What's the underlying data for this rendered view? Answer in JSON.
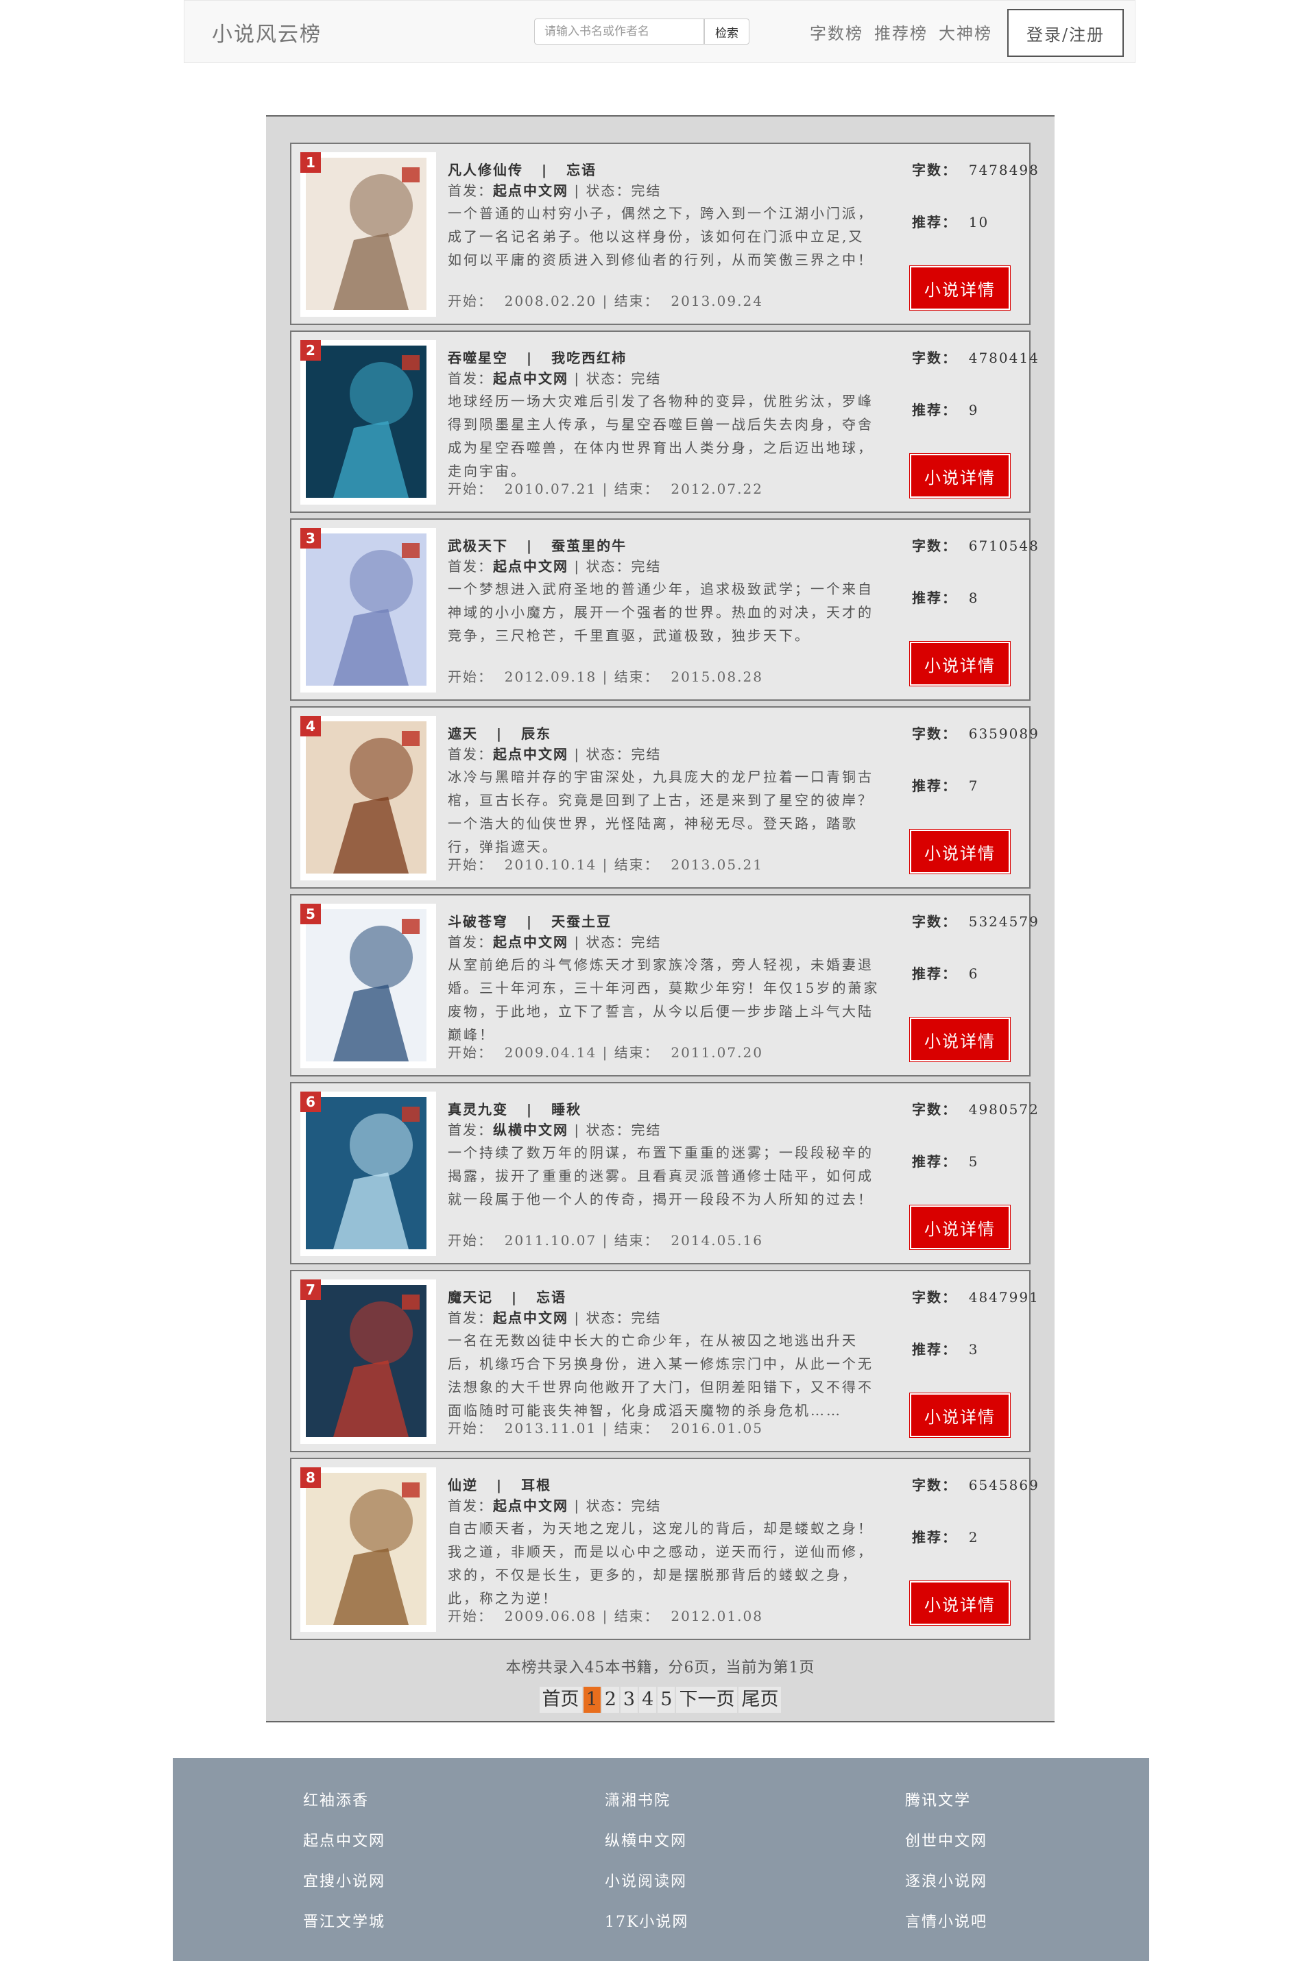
{
  "header": {
    "brand": "小说风云榜",
    "search_placeholder": "请输入书名或作者名",
    "search_button": "检索",
    "nav": [
      "字数榜",
      "推荐榜",
      "大神榜"
    ],
    "login": "登录/注册"
  },
  "labels": {
    "first_pub": "首发：",
    "status": "状态：",
    "start": "开始：",
    "end": "结束：",
    "words": "字数：",
    "recommend": "推荐：",
    "detail_button": "小说详情"
  },
  "books": [
    {
      "rank": "1",
      "title": "凡人修仙传",
      "author": "忘语",
      "site": "起点中文网",
      "status": "完结",
      "desc": "一个普通的山村穷小子，偶然之下，跨入到一个江湖小门派，成了一名记名弟子。他以这样身份，该如何在门派中立足,又如何以平庸的资质进入到修仙者的行列，从而笑傲三界之中！",
      "start": "2008.02.20",
      "end": "2013.09.24",
      "words": "7478498",
      "recommend": "10",
      "cover_bg": "#efe6dc",
      "cover_accent": "#8a6a50"
    },
    {
      "rank": "2",
      "title": "吞噬星空",
      "author": "我吃西红柿",
      "site": "起点中文网",
      "status": "完结",
      "desc": "地球经历一场大灾难后引发了各物种的变异，优胜劣汰，罗峰得到陨墨星主人传承，与星空吞噬巨兽一战后失去肉身，夺舍成为星空吞噬兽，在体内世界育出人类分身，之后迈出地球，走向宇宙。",
      "start": "2010.07.21",
      "end": "2012.07.22",
      "words": "4780414",
      "recommend": "9",
      "cover_bg": "#0f3c55",
      "cover_accent": "#3ea9c9"
    },
    {
      "rank": "3",
      "title": "武极天下",
      "author": "蚕茧里的牛",
      "site": "起点中文网",
      "status": "完结",
      "desc": "一个梦想进入武府圣地的普通少年，追求极致武学；一个来自神域的小小魔方，展开一个强者的世界。热血的对决，天才的竞争，三尺枪芒，千里直驱，武道极致，独步天下。",
      "start": "2012.09.18",
      "end": "2015.08.28",
      "words": "6710548",
      "recommend": "8",
      "cover_bg": "#c9d3ee",
      "cover_accent": "#6f7fb8"
    },
    {
      "rank": "4",
      "title": "遮天",
      "author": "辰东",
      "site": "起点中文网",
      "status": "完结",
      "desc": "冰冷与黑暗并存的宇宙深处，九具庞大的龙尸拉着一口青铜古棺，亘古长存。究竟是回到了上古，还是来到了星空的彼岸？一个浩大的仙侠世界，光怪陆离，神秘无尽。登天路，踏歌行，弹指遮天。",
      "start": "2010.10.14",
      "end": "2013.05.21",
      "words": "6359089",
      "recommend": "7",
      "cover_bg": "#e9d7c2",
      "cover_accent": "#7a3a1a"
    },
    {
      "rank": "5",
      "title": "斗破苍穹",
      "author": "天蚕土豆",
      "site": "起点中文网",
      "status": "完结",
      "desc": "从室前绝后的斗气修炼天才到家族冷落，旁人轻视，未婚妻退婚。三十年河东，三十年河西，莫欺少年穷！年仅15岁的萧家废物，于此地，立下了誓言，从今以后便一步步踏上斗气大陆巅峰！",
      "start": "2009.04.14",
      "end": "2011.07.20",
      "words": "5324579",
      "recommend": "6",
      "cover_bg": "#eef2f7",
      "cover_accent": "#2a4e7a"
    },
    {
      "rank": "6",
      "title": "真灵九变",
      "author": "睡秋",
      "site": "纵横中文网",
      "status": "完结",
      "desc": "一个持续了数万年的阴谋，布置下重重的迷雾；一段段秘辛的揭露，拔开了重重的迷雾。且看真灵派普通修士陆平，如何成就一段属于他一个人的传奇，揭开一段段不为人所知的过去！",
      "start": "2011.10.07",
      "end": "2014.05.16",
      "words": "4980572",
      "recommend": "5",
      "cover_bg": "#1f5a80",
      "cover_accent": "#bfe3f3"
    },
    {
      "rank": "7",
      "title": "魔天记",
      "author": "忘语",
      "site": "起点中文网",
      "status": "完结",
      "desc": "一名在无数凶徒中长大的亡命少年，在从被囚之地逃出升天后，机缘巧合下另换身份，进入某一修炼宗门中，从此一个无法想象的大千世界向他敞开了大门，但阴差阳错下，又不得不面临随时可能丧失神智，化身成滔天魔物的杀身危机……",
      "start": "2013.11.01",
      "end": "2016.01.05",
      "words": "4847991",
      "recommend": "3",
      "cover_bg": "#1d3a54",
      "cover_accent": "#c0392b"
    },
    {
      "rank": "8",
      "title": "仙逆",
      "author": "耳根",
      "site": "起点中文网",
      "status": "完结",
      "desc": "自古顺天者，为天地之宠儿，这宠儿的背后，却是蝼蚁之身！我之道，非顺天，而是以心中之感动，逆天而行，逆仙而修，求的，不仅是长生，更多的，却是摆脱那背后的蝼蚁之身，此，称之为逆！",
      "start": "2009.06.08",
      "end": "2012.01.08",
      "words": "6545869",
      "recommend": "2",
      "cover_bg": "#efe4cf",
      "cover_accent": "#8a5a2a"
    }
  ],
  "summary": "本榜共录入45本书籍，分6页，当前为第1页",
  "pager": [
    "首页",
    "1",
    "2",
    "3",
    "4",
    "5",
    "下一页",
    "尾页"
  ],
  "footer_links": [
    [
      "红袖添香",
      "潇湘书院",
      "腾讯文学"
    ],
    [
      "起点中文网",
      "纵横中文网",
      "创世中文网"
    ],
    [
      "宜搜小说网",
      "小说阅读网",
      "逐浪小说网"
    ],
    [
      "晋江文学城",
      "17K小说网",
      "言情小说吧"
    ]
  ],
  "colors": {
    "accent": "#d90000",
    "pager_current": "#e86e1d",
    "footer_bg": "#8c99a6"
  }
}
